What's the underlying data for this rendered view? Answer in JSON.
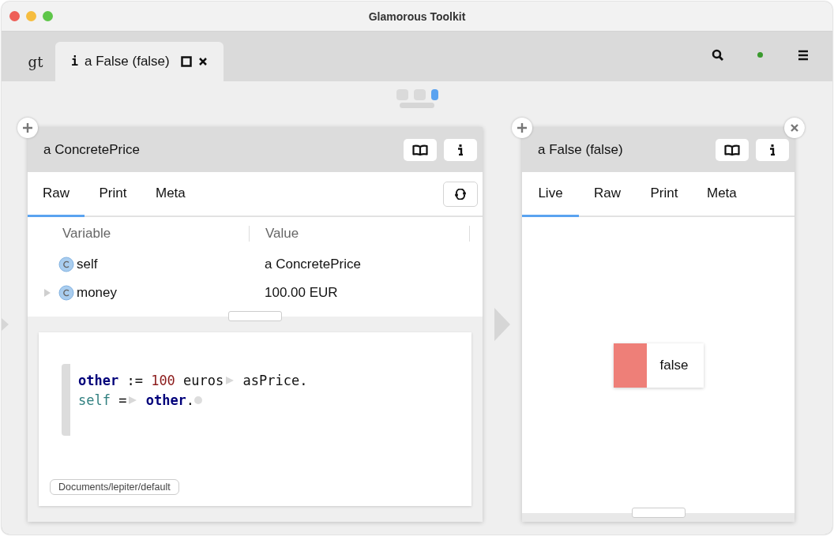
{
  "window": {
    "title": "Glamorous Toolkit"
  },
  "tabs": [
    {
      "kind": "logo",
      "label": "gt",
      "selected": false
    },
    {
      "kind": "inspector",
      "icon": "i",
      "label": "a False (false)",
      "selected": true
    }
  ],
  "pager": [
    {
      "selected": false
    },
    {
      "selected": false
    },
    {
      "selected": true
    }
  ],
  "panes": [
    {
      "title": "a ConcretePrice",
      "has_add": true,
      "has_close": false,
      "has_refresh": true,
      "tabs": [
        {
          "label": "Raw",
          "selected": true
        },
        {
          "label": "Print",
          "selected": false
        },
        {
          "label": "Meta",
          "selected": false
        }
      ],
      "body": {
        "kind": "raw",
        "columns": [
          "Variable",
          "Value"
        ],
        "rows": [
          {
            "variable": "self",
            "value": "a ConcretePrice",
            "expandable": false
          },
          {
            "variable": "money",
            "value": "100.00 EUR",
            "expandable": true
          }
        ],
        "code": [
          [
            {
              "kind": "keyword",
              "text": "other"
            },
            {
              "kind": "plain",
              "text": " := "
            },
            {
              "kind": "number",
              "text": "100"
            },
            {
              "kind": "plain",
              "text": " euros"
            },
            {
              "kind": "marker"
            },
            {
              "kind": "plain",
              "text": " asPrice."
            }
          ],
          [
            {
              "kind": "variable",
              "text": "self"
            },
            {
              "kind": "plain",
              "text": " ="
            },
            {
              "kind": "marker"
            },
            {
              "kind": "keyword",
              "text": " other"
            },
            {
              "kind": "plain",
              "text": "."
            },
            {
              "kind": "dot"
            }
          ]
        ],
        "path": "Documents/lepiter/default"
      }
    },
    {
      "title": "a False (false)",
      "has_add": true,
      "has_close": true,
      "has_refresh": false,
      "tabs": [
        {
          "label": "Live",
          "selected": true
        },
        {
          "label": "Raw",
          "selected": false
        },
        {
          "label": "Print",
          "selected": false
        },
        {
          "label": "Meta",
          "selected": false
        }
      ],
      "body": {
        "kind": "live",
        "value": "false",
        "color": "#ee7f78"
      }
    }
  ]
}
